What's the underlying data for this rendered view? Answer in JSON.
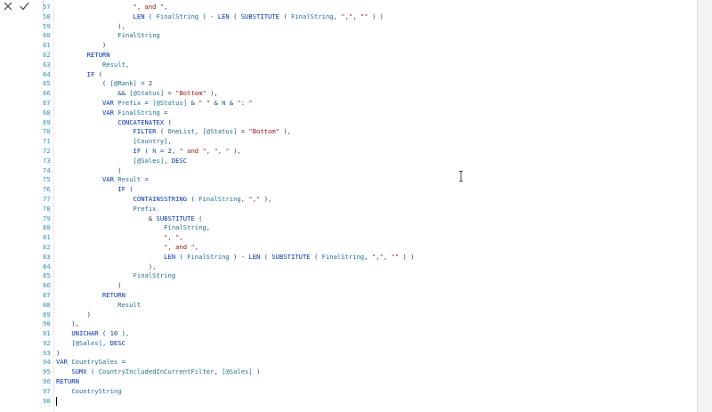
{
  "toolbar": {
    "cancel_icon": "close-icon",
    "commit_icon": "checkmark-icon"
  },
  "editor": {
    "lines": [
      {
        "num": "57",
        "text": "                    \", and \","
      },
      {
        "num": "58",
        "text": "                    LEN ( FinalString ) - LEN ( SUBSTITUTE ( FinalString, \",\", \"\" ) )"
      },
      {
        "num": "59",
        "text": "                ),"
      },
      {
        "num": "60",
        "text": "                FinalString"
      },
      {
        "num": "61",
        "text": "            )"
      },
      {
        "num": "62",
        "text": "        RETURN"
      },
      {
        "num": "63",
        "text": "            Result,"
      },
      {
        "num": "64",
        "text": "        IF ("
      },
      {
        "num": "65",
        "text": "            ( [@Rank] = 2"
      },
      {
        "num": "66",
        "text": "                && [@Status] = \"Bottom\" ),"
      },
      {
        "num": "67",
        "text": "            VAR Prefix = [@Status] & \" \" & N & \": \""
      },
      {
        "num": "68",
        "text": "            VAR FinalString ="
      },
      {
        "num": "69",
        "text": "                CONCATENATEX ("
      },
      {
        "num": "70",
        "text": "                    FILTER ( OneList, [@Status] = \"Bottom\" ),"
      },
      {
        "num": "71",
        "text": "                    [Country],"
      },
      {
        "num": "72",
        "text": "                    IF ( N = 2, \" and \", \", \" ),"
      },
      {
        "num": "73",
        "text": "                    [@Sales], DESC"
      },
      {
        "num": "74",
        "text": "                )"
      },
      {
        "num": "75",
        "text": "            VAR Result ="
      },
      {
        "num": "76",
        "text": "                IF ("
      },
      {
        "num": "77",
        "text": "                    CONTAINSSTRING ( FinalString, \",\" ),"
      },
      {
        "num": "78",
        "text": "                    Prefix"
      },
      {
        "num": "79",
        "text": "                        & SUBSTITUTE ("
      },
      {
        "num": "80",
        "text": "                            FinalString,"
      },
      {
        "num": "81",
        "text": "                            \", \","
      },
      {
        "num": "82",
        "text": "                            \", and \","
      },
      {
        "num": "83",
        "text": "                            LEN ( FinalString ) - LEN ( SUBSTITUTE ( FinalString, \",\", \"\" ) )"
      },
      {
        "num": "84",
        "text": "                        ),"
      },
      {
        "num": "85",
        "text": "                    FinalString"
      },
      {
        "num": "86",
        "text": "                )"
      },
      {
        "num": "87",
        "text": "            RETURN"
      },
      {
        "num": "88",
        "text": "                Result"
      },
      {
        "num": "89",
        "text": "        )"
      },
      {
        "num": "90",
        "text": "    ),"
      },
      {
        "num": "91",
        "text": "    UNICHAR ( 10 ),"
      },
      {
        "num": "92",
        "text": "    [@Sales], DESC"
      },
      {
        "num": "93",
        "text": ")"
      },
      {
        "num": "94",
        "text": "VAR CountrySales ="
      },
      {
        "num": "95",
        "text": "    SUMX ( CountryIncludedInCurrentFilter, [@Sales] )"
      },
      {
        "num": "96",
        "text": "RETURN"
      },
      {
        "num": "97",
        "text": "    CountryString"
      },
      {
        "num": "98",
        "text": ""
      }
    ]
  },
  "colors": {
    "line_number": "#2b91af",
    "keyword": "#0033b3",
    "string": "#a31515",
    "text": "#1a3d7a",
    "background": "#ffffff"
  }
}
